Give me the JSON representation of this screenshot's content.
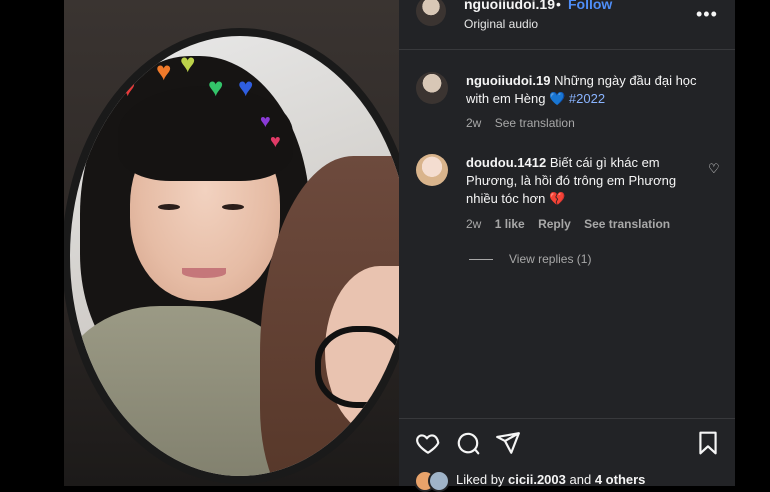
{
  "post": {
    "username": "nguoiiudoi.19",
    "follow_label": "Follow",
    "audio": "Original audio"
  },
  "caption": {
    "username": "nguoiiudoi.19",
    "text": "Những ngày đầu đại học with em Hèng 💙",
    "hashtag": "#2022",
    "time": "2w",
    "see_translation": "See translation"
  },
  "comment": {
    "username": "doudou.1412",
    "text": "Biết cái gì khác em Phương, là hồi đó trông em Phương nhiều tóc hơn 💔",
    "time": "2w",
    "likes": "1 like",
    "reply": "Reply",
    "see_translation": "See translation",
    "view_replies": "View replies (1)"
  },
  "likes": {
    "prefix": "Liked by",
    "user": "cicii.2003",
    "and": "and",
    "others": "4 others"
  },
  "icons": {
    "more": "more-horizontal-icon",
    "like": "heart-icon",
    "comment": "comment-icon",
    "share": "share-icon",
    "save": "bookmark-icon"
  },
  "colors": {
    "panel_bg": "#222326",
    "link": "#4f8ef7",
    "hashtag": "#8ab4ff",
    "muted": "#a8a8a8"
  }
}
